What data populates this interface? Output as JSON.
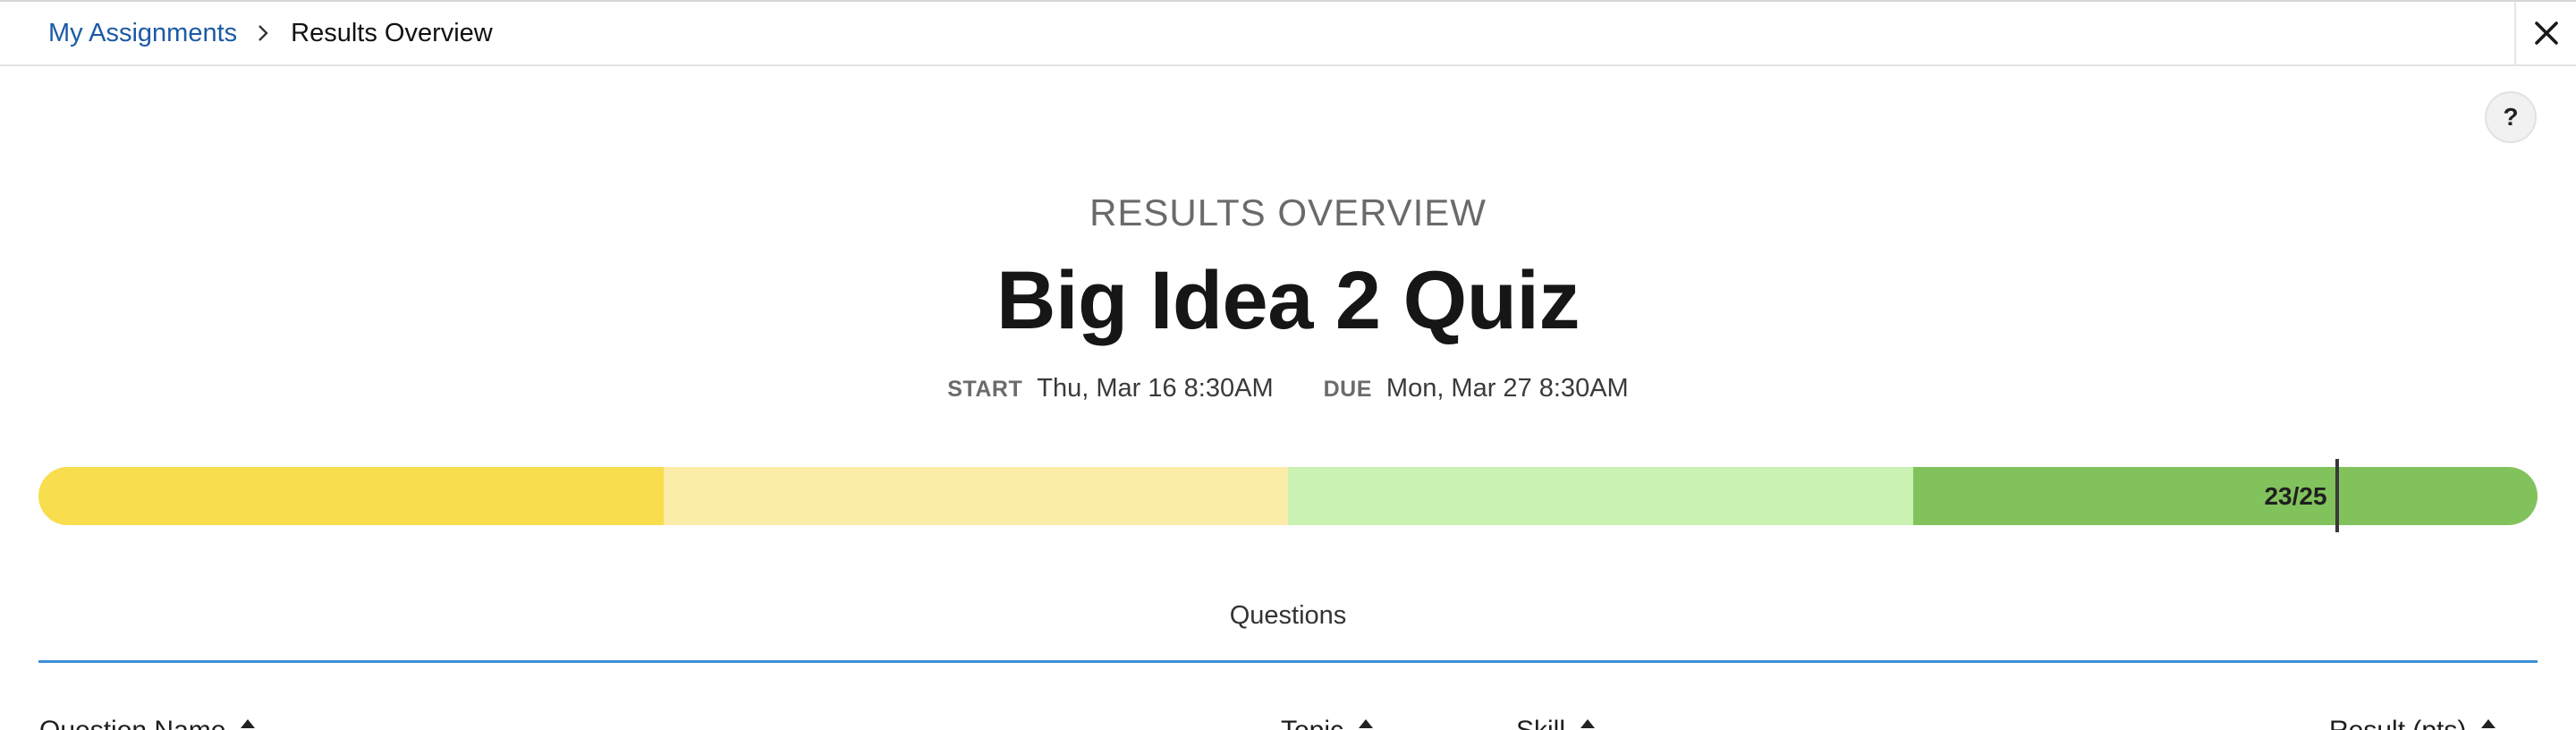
{
  "breadcrumb": {
    "parent": "My Assignments",
    "current": "Results Overview"
  },
  "header": {
    "overline": "RESULTS OVERVIEW",
    "title": "Big Idea 2 Quiz",
    "start_label": "START",
    "start_value": "Thu, Mar 16 8:30AM",
    "due_label": "DUE",
    "due_value": "Mon, Mar 27 8:30AM"
  },
  "help": {
    "label": "?"
  },
  "score": {
    "text": "23/25",
    "earned": 23,
    "total": 25,
    "segment_colors": [
      "#f8dd4e",
      "#fbeca8",
      "#c9f2b3",
      "#82c25d"
    ],
    "marker_color": "#3a3a3a"
  },
  "tabs": [
    {
      "label": "Questions",
      "active": true
    }
  ],
  "table": {
    "columns": [
      {
        "label": "Question Name"
      },
      {
        "label": "Topic"
      },
      {
        "label": "Skill"
      },
      {
        "label": "Result (pts)"
      }
    ]
  },
  "icons": {
    "breadcrumb_separator": "chevron-right-icon",
    "close": "close-icon",
    "sort": "sort-icon"
  },
  "colors": {
    "link": "#1c5aa6",
    "accent": "#3b8fd6"
  }
}
